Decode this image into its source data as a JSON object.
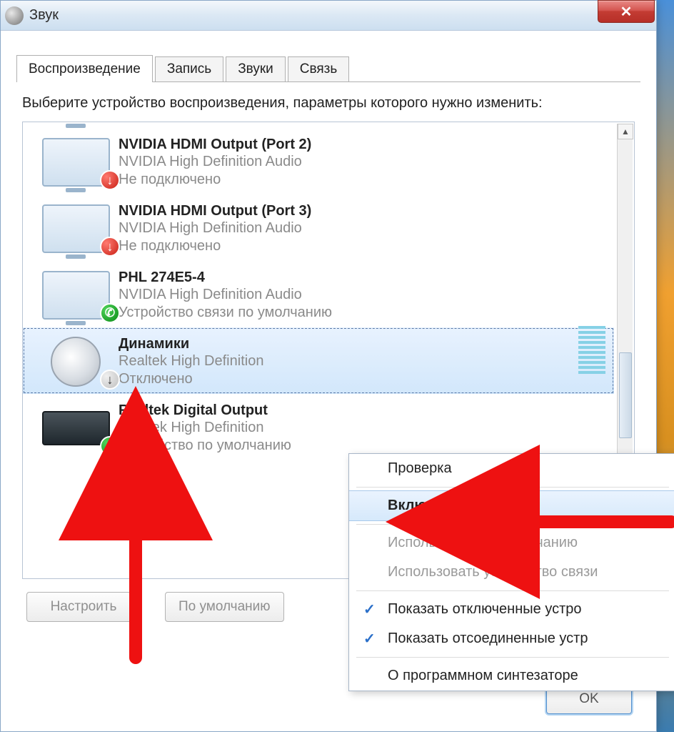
{
  "window": {
    "title": "Звук",
    "close": "×"
  },
  "tabs": {
    "playback": "Воспроизведение",
    "recording": "Запись",
    "sounds": "Звуки",
    "communications": "Связь"
  },
  "instruction": "Выберите устройство воспроизведения, параметры которого нужно изменить:",
  "devices": [
    {
      "name": "NVIDIA HDMI Output (Port 2)",
      "driver": "NVIDIA High Definition Audio",
      "status": "Не подключено"
    },
    {
      "name": "NVIDIA HDMI Output (Port 3)",
      "driver": "NVIDIA High Definition Audio",
      "status": "Не подключено"
    },
    {
      "name": "PHL 274E5-4",
      "driver": "NVIDIA High Definition Audio",
      "status": "Устройство связи по умолчанию"
    },
    {
      "name": "Динамики",
      "driver": "Realtek High Definition",
      "status": "Отключено"
    },
    {
      "name": "Realtek Digital Output",
      "driver": "Realtek High Definition",
      "status": "Устройство по умолчанию"
    }
  ],
  "buttons": {
    "configure": "Настроить",
    "default": "По умолчанию",
    "ok": "OK"
  },
  "context_menu": {
    "test": "Проверка",
    "enable": "Включить",
    "set_default": "Использовать по умолчанию",
    "set_comm": "Использовать устройство связи",
    "show_disabled": "Показать отключенные устро",
    "show_disconnected": "Показать отсоединенные устр",
    "about_synth": "О программном синтезаторе"
  }
}
